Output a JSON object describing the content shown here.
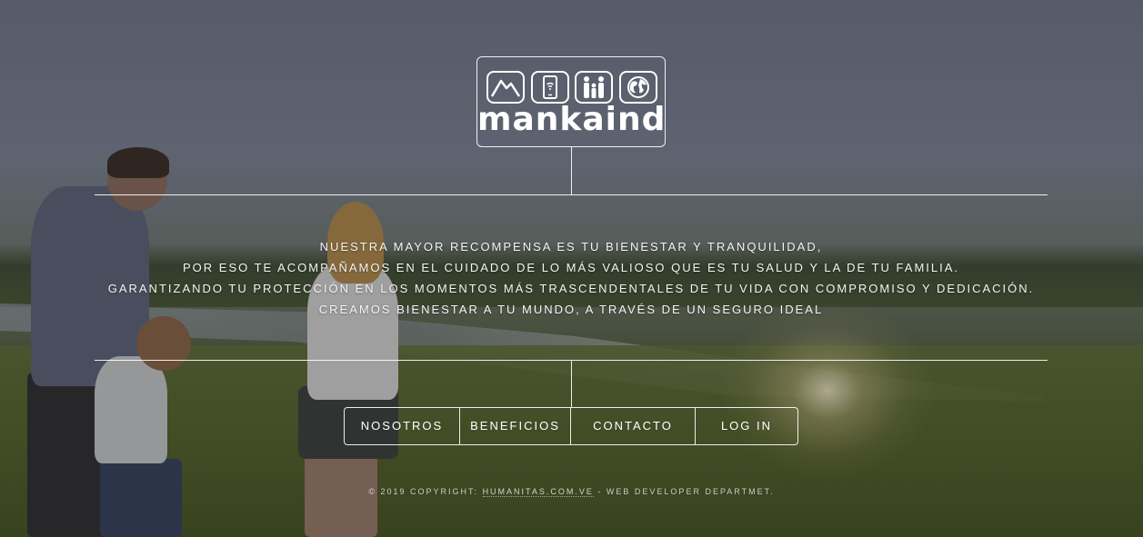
{
  "logo": {
    "text": "mankaind",
    "icons": [
      "mountain-icon",
      "phone-wifi-icon",
      "family-icon",
      "globe-icon"
    ]
  },
  "tagline": {
    "lines": [
      "NUESTRA MAYOR RECOMPENSA ES TU BIENESTAR Y TRANQUILIDAD,",
      "POR ESO TE ACOMPAÑAMOS EN EL CUIDADO DE LO MÁS VALIOSO QUE ES TU SALUD Y LA DE TU FAMILIA.",
      "GARANTIZANDO TU PROTECCIÓN EN LOS MOMENTOS MÁS TRASCENDENTALES DE TU VIDA CON COMPROMISO Y DEDICACIÓN.",
      "CREAMOS BIENESTAR A TU MUNDO, A TRAVÉS DE UN SEGURO IDEAL"
    ]
  },
  "nav": {
    "items": [
      {
        "label": "NOSOTROS"
      },
      {
        "label": "BENEFICIOS"
      },
      {
        "label": "CONTACTO"
      },
      {
        "label": "LOG IN"
      }
    ]
  },
  "footer": {
    "prefix": "© 2019 COPYRIGHT:",
    "link": "HUMANITAS.COM.VE",
    "suffix": "- WEB DEVELOPER DEPARTMET."
  }
}
